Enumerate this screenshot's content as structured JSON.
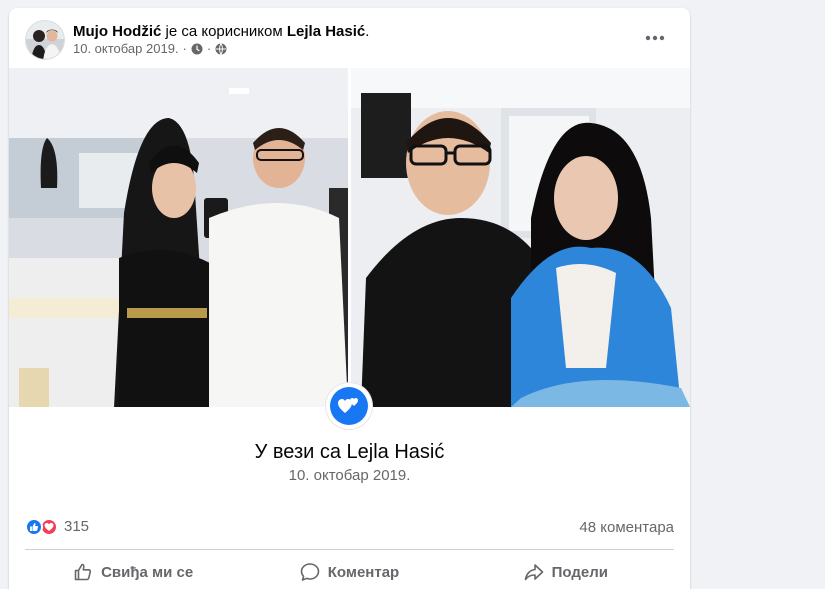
{
  "post": {
    "author": "Mujo Hodžić",
    "connector": " је са корисником ",
    "tagged": "Lejla Hasić",
    "period": ".",
    "date": "10. октобар 2019.",
    "more_icon": "more-dots-icon",
    "privacy_icon": "globe-icon"
  },
  "relationship": {
    "title": "У вези са Lejla Hasić",
    "date": "10. октобар 2019.",
    "icon": "hearts-icon"
  },
  "stats": {
    "reactions_count": "315",
    "comments": "48 коментара",
    "reaction_icons": [
      "like-icon",
      "love-icon"
    ]
  },
  "actions": {
    "like": "Свиђа ми се",
    "comment": "Коментар",
    "share": "Подели"
  },
  "colors": {
    "accent": "#1877f2",
    "love": "#f33e58",
    "secondary_text": "#65676b"
  }
}
